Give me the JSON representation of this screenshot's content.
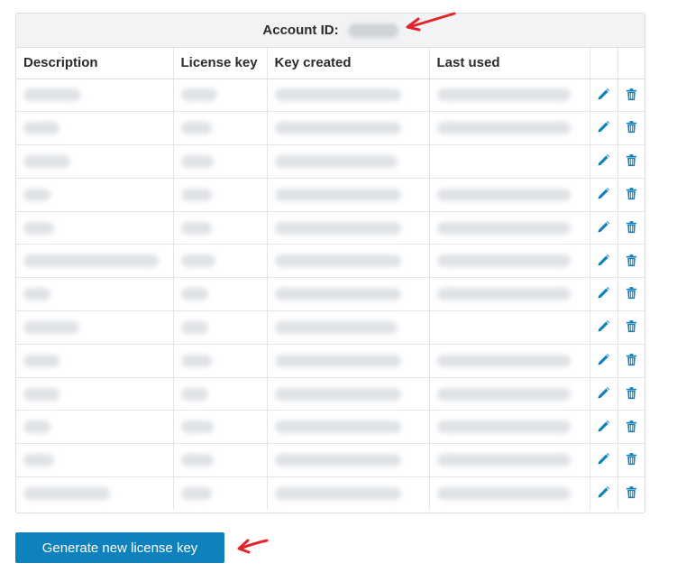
{
  "account": {
    "label": "Account ID:",
    "value": ""
  },
  "table": {
    "headers": [
      "Description",
      "License key",
      "Key created",
      "Last used"
    ],
    "rows": [
      {
        "desc_w": 64,
        "key_w": 40,
        "created_w": 140,
        "used_w": 148
      },
      {
        "desc_w": 40,
        "key_w": 34,
        "created_w": 140,
        "used_w": 148
      },
      {
        "desc_w": 52,
        "key_w": 36,
        "created_w": 136,
        "used_w": 0
      },
      {
        "desc_w": 30,
        "key_w": 34,
        "created_w": 140,
        "used_w": 148
      },
      {
        "desc_w": 34,
        "key_w": 34,
        "created_w": 140,
        "used_w": 148
      },
      {
        "desc_w": 150,
        "key_w": 38,
        "created_w": 140,
        "used_w": 148
      },
      {
        "desc_w": 30,
        "key_w": 30,
        "created_w": 140,
        "used_w": 148
      },
      {
        "desc_w": 62,
        "key_w": 30,
        "created_w": 136,
        "used_w": 0
      },
      {
        "desc_w": 40,
        "key_w": 34,
        "created_w": 140,
        "used_w": 148
      },
      {
        "desc_w": 40,
        "key_w": 30,
        "created_w": 140,
        "used_w": 148
      },
      {
        "desc_w": 30,
        "key_w": 36,
        "created_w": 140,
        "used_w": 148
      },
      {
        "desc_w": 34,
        "key_w": 36,
        "created_w": 140,
        "used_w": 148
      },
      {
        "desc_w": 96,
        "key_w": 34,
        "created_w": 140,
        "used_w": 148
      }
    ]
  },
  "actions": {
    "edit_icon": "pencil-icon",
    "delete_icon": "trash-icon"
  },
  "generate_button": {
    "label": "Generate new license key"
  },
  "colors": {
    "accent": "#0f82bd",
    "annotation_arrow": "#e0262b"
  }
}
